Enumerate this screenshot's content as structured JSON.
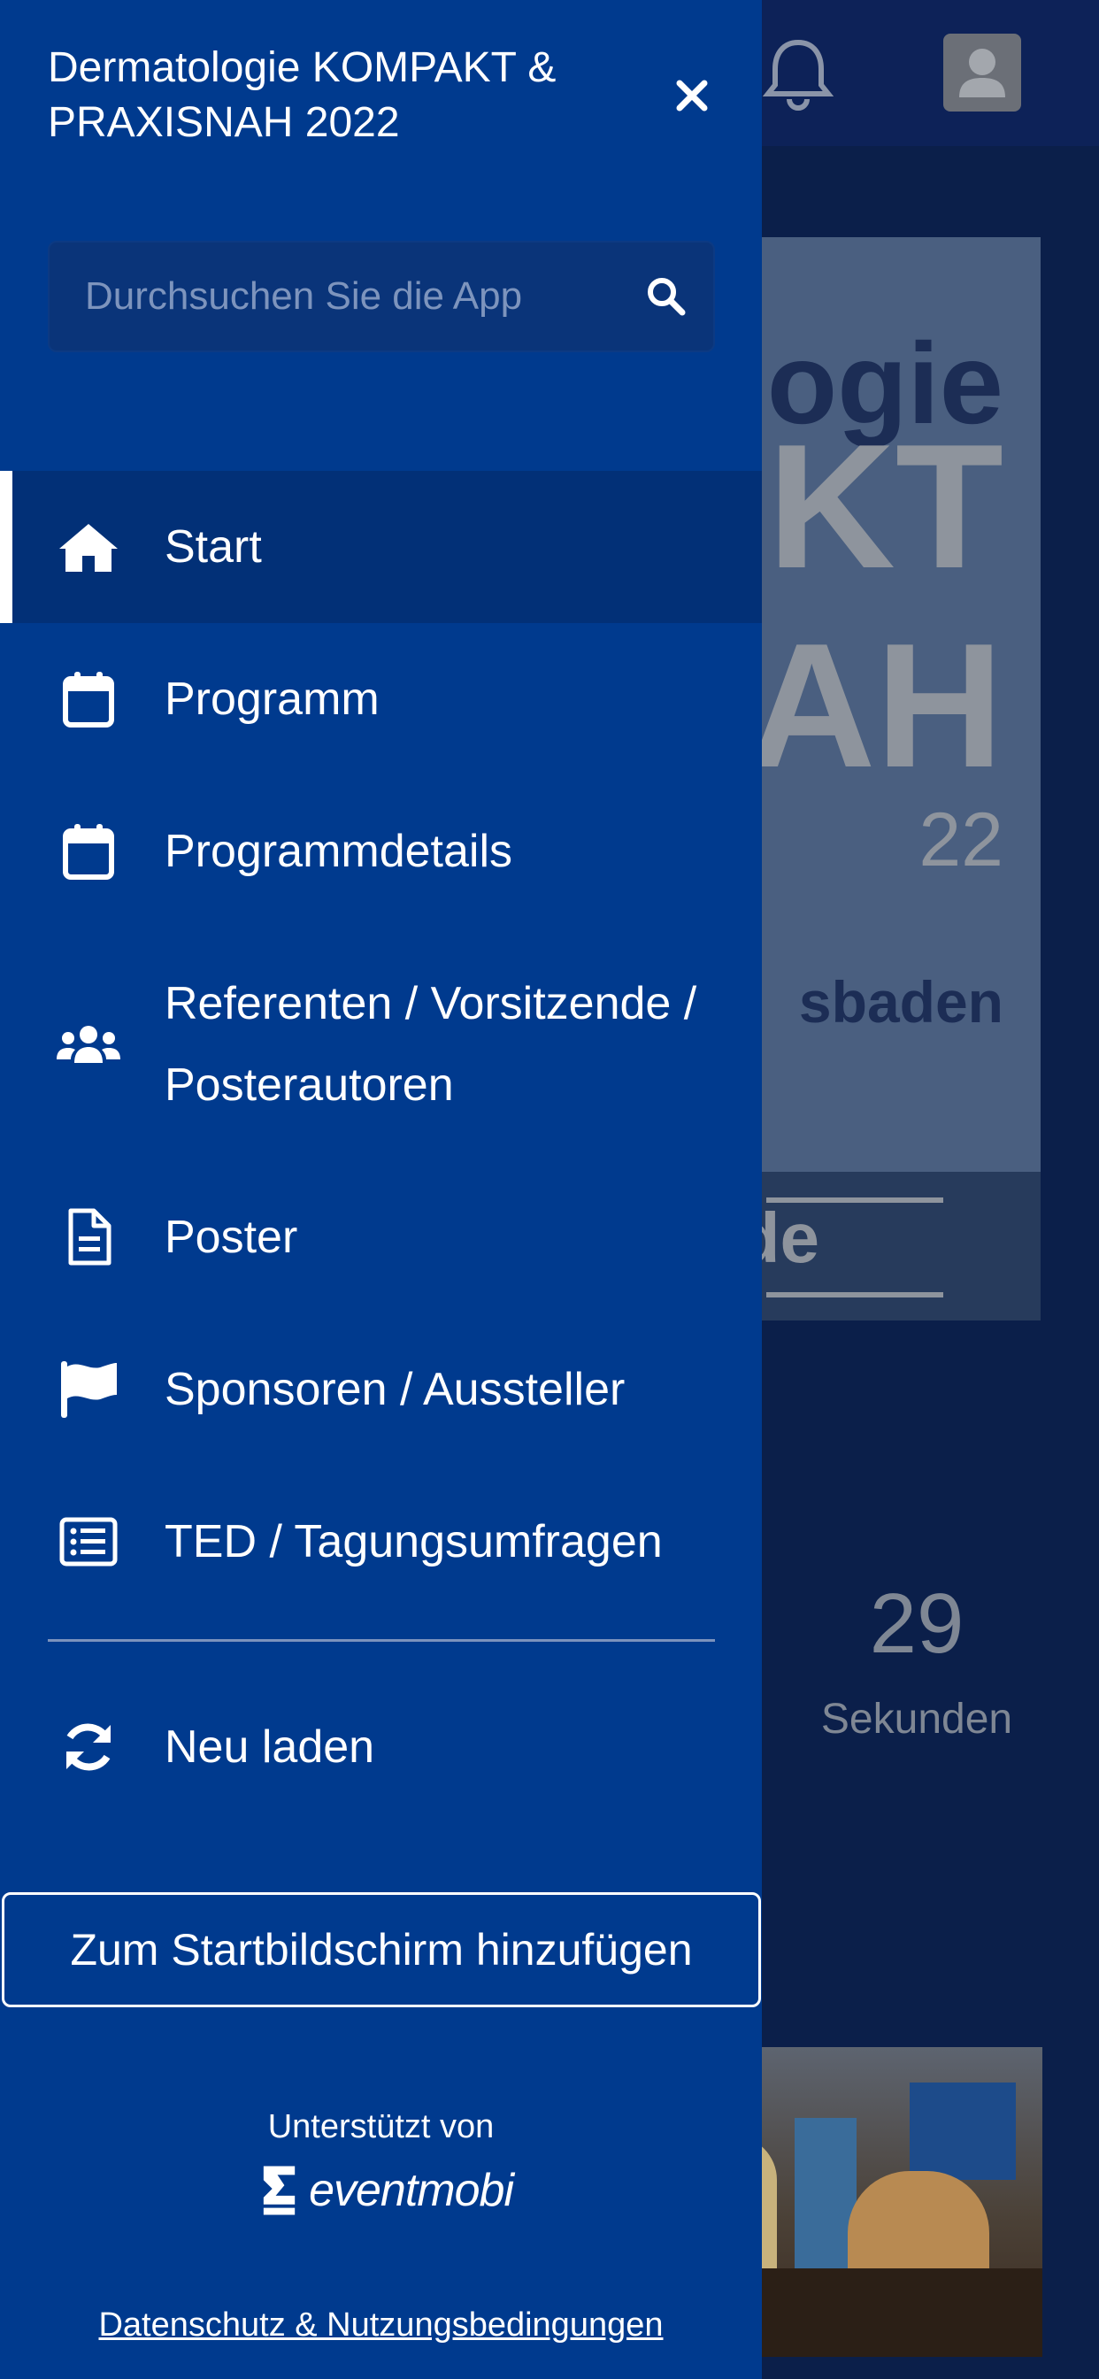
{
  "background": {
    "banner_lines": [
      "ogie",
      "KT",
      "IAH",
      "22",
      "sbaden",
      ".de"
    ],
    "countdown": {
      "value": "29",
      "label": "Sekunden"
    }
  },
  "drawer": {
    "title": "Dermatologie KOMPAKT & PRAXISNAH 2022",
    "search": {
      "placeholder": "Durchsuchen Sie die App"
    },
    "menu": [
      {
        "label": "Start",
        "icon": "home-icon",
        "active": true
      },
      {
        "label": "Programm",
        "icon": "calendar-icon"
      },
      {
        "label": "Programmdetails",
        "icon": "calendar-icon"
      },
      {
        "label": "Referenten / Vorsitzende / Posterautoren",
        "icon": "users-icon"
      },
      {
        "label": "Poster",
        "icon": "document-icon"
      },
      {
        "label": "Sponsoren / Aussteller",
        "icon": "flag-icon"
      },
      {
        "label": "TED / Tagungsumfragen",
        "icon": "list-icon"
      },
      {
        "label": "Neu laden",
        "icon": "refresh-icon"
      }
    ],
    "add_home_label": "Zum Startbildschirm hinzufügen",
    "powered_by": "Unterstützt von",
    "brand_name": "eventmobi",
    "privacy_link": "Datenschutz & Nutzungsbedingungen"
  },
  "colors": {
    "drawer_bg": "#003a8e",
    "active_bg": "#023077",
    "overlay_bg": "#0b1f4a"
  }
}
